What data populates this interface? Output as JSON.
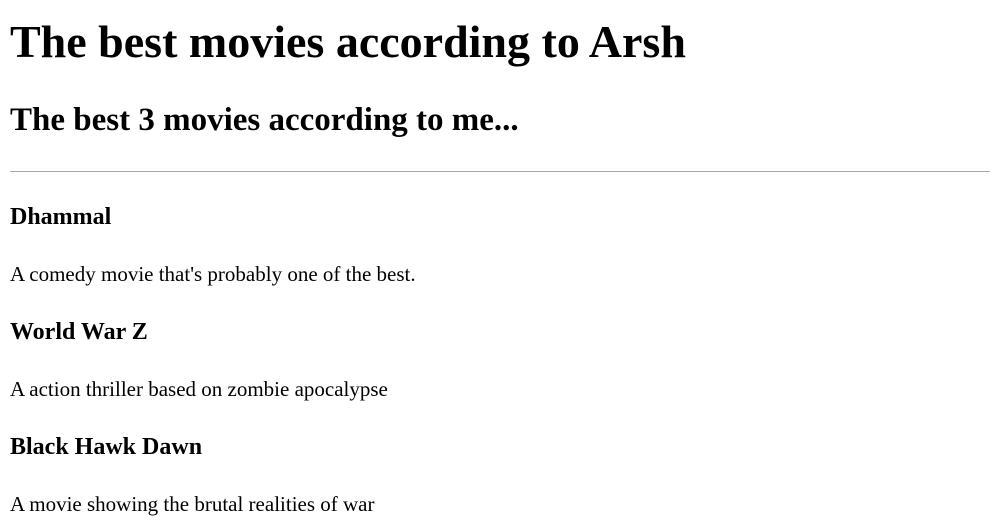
{
  "header": {
    "title": "The best movies according to Arsh",
    "subtitle": "The best 3 movies according to me..."
  },
  "movies": [
    {
      "title": "Dhammal",
      "description": "A comedy movie that's probably one of the best."
    },
    {
      "title": "World War Z",
      "description": "A action thriller based on zombie apocalypse"
    },
    {
      "title": "Black Hawk Dawn",
      "description": "A movie showing the brutal realities of war"
    }
  ]
}
